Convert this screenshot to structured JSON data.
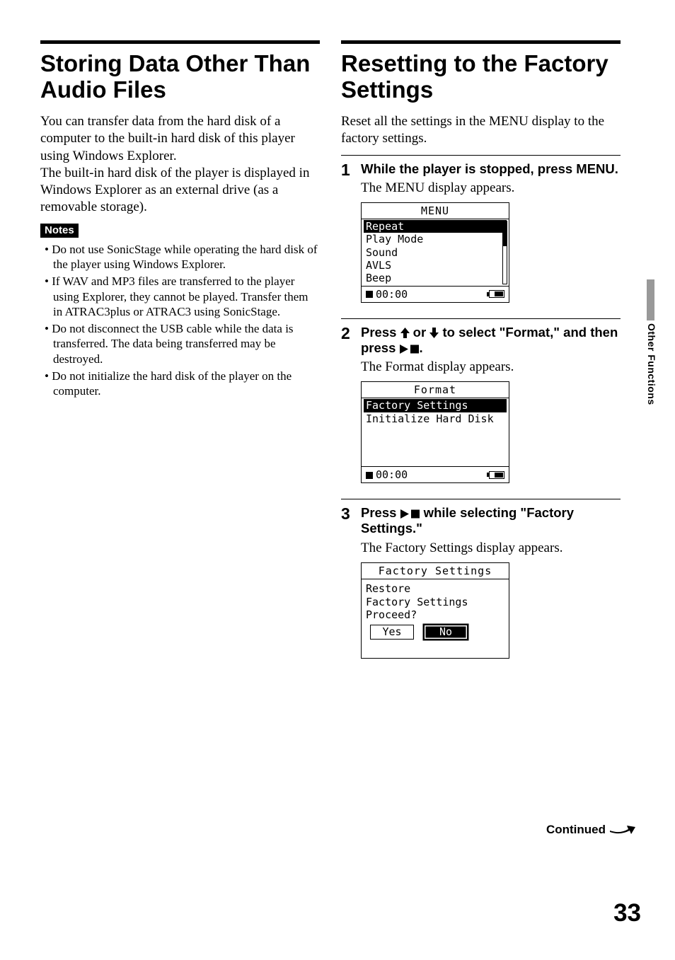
{
  "left": {
    "title": "Storing Data Other Than Audio Files",
    "para": "You can transfer data from the hard disk of a computer to the built-in hard disk of this player using Windows Explorer.\nThe built-in hard disk of the player is displayed in Windows Explorer as an external drive (as a removable storage).",
    "notes_label": "Notes",
    "notes": [
      "Do not use SonicStage while operating the hard disk of the player using Windows Explorer.",
      "If WAV and MP3 files are transferred to the player using Explorer, they cannot be played. Transfer them in ATRAC3plus or ATRAC3 using SonicStage.",
      "Do not disconnect the USB cable while the data is transferred. The data being transferred may be destroyed.",
      "Do not initialize the hard disk of the player on the computer."
    ]
  },
  "right": {
    "title": "Resetting to the Factory Settings",
    "intro": "Reset all the settings in the MENU display to the factory settings.",
    "steps": [
      {
        "num": "1",
        "head": "While the player is stopped, press MENU.",
        "sub": "The MENU display appears.",
        "lcd": {
          "title": "MENU",
          "items": [
            "Repeat",
            "Play Mode",
            "Sound",
            "AVLS",
            "Beep"
          ],
          "selected": 0,
          "time": "00:00"
        }
      },
      {
        "num": "2",
        "head_pre": "Press ",
        "head_mid": " or ",
        "head_post": " to select \"Format,\" and then press ",
        "head_end": ".",
        "sub": "The Format display appears.",
        "lcd": {
          "title": "Format",
          "items": [
            "Factory Settings",
            "Initialize Hard Disk"
          ],
          "selected": 0,
          "time": "00:00"
        }
      },
      {
        "num": "3",
        "head_pre": "Press ",
        "head_post": " while selecting \"Factory Settings.\"",
        "sub": "The Factory Settings display appears.",
        "lcd": {
          "title": "Factory Settings",
          "message": [
            "Restore",
            "Factory Settings",
            "Proceed?"
          ],
          "buttons": [
            "Yes",
            "No"
          ],
          "selected_button": 1
        }
      }
    ]
  },
  "sidebar_label": "Other Functions",
  "continued": "Continued",
  "page_number": "33"
}
